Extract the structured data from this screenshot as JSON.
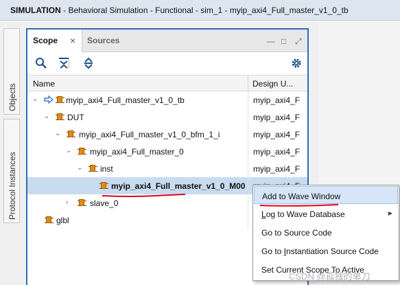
{
  "titlebar": {
    "label": "SIMULATION",
    "text": " - Behavioral Simulation - Functional - sim_1 - myip_axi4_Full_master_v1_0_tb"
  },
  "side_tabs": {
    "objects": "Objects",
    "protocol": "Protocol Instances"
  },
  "panel": {
    "tabs": {
      "scope": "Scope",
      "sources": "Sources",
      "close": "×"
    },
    "window_controls": {
      "minimize": "—",
      "restore": "□",
      "close": "⤢"
    },
    "columns": {
      "name": "Name",
      "design_unit": "Design U..."
    }
  },
  "tree": [
    {
      "label": "myip_axi4_Full_master_v1_0_tb",
      "design_unit": "myip_axi4_F"
    },
    {
      "label": "DUT",
      "design_unit": "myip_axi4_F"
    },
    {
      "label": "myip_axi4_Full_master_v1_0_bfm_1_i",
      "design_unit": "myip_axi4_F"
    },
    {
      "label": "myip_axi4_Full_master_0",
      "design_unit": "myip_axi4_F"
    },
    {
      "label": "inst",
      "design_unit": "myip_axi4_F"
    },
    {
      "label": "myip_axi4_Full_master_v1_0_M00",
      "design_unit": "myip_axi4_F"
    },
    {
      "label": "slave_0",
      "design_unit": ""
    },
    {
      "label": "glbl",
      "design_unit": ""
    }
  ],
  "context_menu": {
    "add_to_wave": "Add to Wave Window",
    "log_to_wave": {
      "prefix": "",
      "u": "L",
      "rest": "og to Wave Database"
    },
    "goto_source": "Go to Source Code",
    "goto_inst": {
      "prefix": "Go to ",
      "u": "I",
      "rest": "nstantiation Source Code"
    },
    "set_scope": "Set Current Scope To Active"
  },
  "watermark": "CSDN @孤独的单刀",
  "colors": {
    "accent": "#2b6bb8",
    "selection": "#c8dcf0",
    "module_icon": "#e28a12",
    "annotation": "#e0001b"
  }
}
